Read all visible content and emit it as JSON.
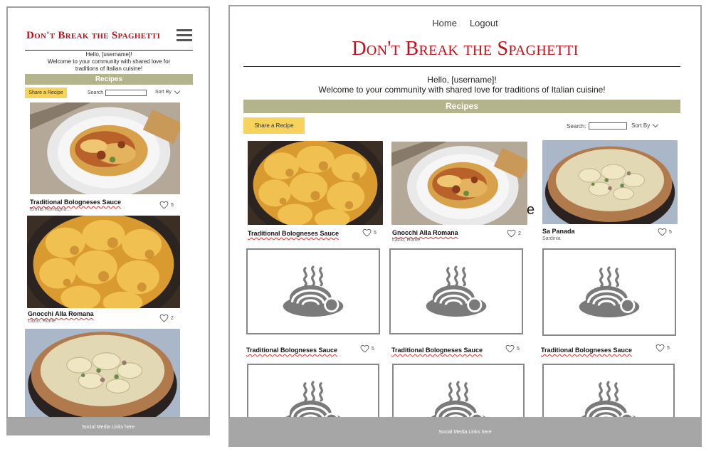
{
  "app": {
    "brand": "Don't Break the Spaghetti",
    "nav": {
      "home": "Home",
      "logout": "Logout"
    },
    "greeting": "Hello, [username]!",
    "welcome": "Welcome to your community with shared love for traditions of Italian cuisine!",
    "mobile_welcome_line1": "Welcome to your community with shared love for",
    "mobile_welcome_line2": "traditions of Italian cuisine!",
    "section_title": "Recipes",
    "share_button": "Share a Recipe",
    "search_label_mobile": "Search",
    "search_label_desktop": "Search:",
    "sort_label": "Sort By",
    "footer": "Social Media Links here"
  },
  "mobile_recipes": [
    {
      "name": "Traditional Bologneses Sauce",
      "location": "Emilia Romagna...",
      "likes": "5",
      "image": "pappardelle-bolognese"
    },
    {
      "name": "Gnocchi Alla Romana",
      "location": "Lazio, Rome",
      "likes": "2",
      "image": "baked-gnocchi"
    },
    {
      "name": "Sa Panada",
      "location": "Sardinia",
      "likes": "5",
      "image": "pie"
    }
  ],
  "desktop_recipes_row1": [
    {
      "name": "Traditional Bologneses Sauce",
      "location": "",
      "likes": "5",
      "image": "baked-gnocchi"
    },
    {
      "name": "Gnocchi Alla Romana",
      "location": "Lazio, Rome",
      "likes": "2",
      "image": "pappardelle-bolognese"
    },
    {
      "name": "Sa Panada",
      "location": "Sardinia",
      "likes": "5",
      "image": "pie"
    }
  ],
  "desktop_recipes_row2": [
    {
      "name": "Traditional Bologneses Sauce",
      "likes": "5",
      "image": "spaghetti-placeholder-icon"
    },
    {
      "name": "Traditional Bologneses Sauce",
      "likes": "5",
      "image": "spaghetti-placeholder-icon"
    },
    {
      "name": "Traditional Bologneses Sauce",
      "likes": "5",
      "image": "spaghetti-placeholder-icon"
    }
  ],
  "stray_glyph": "e",
  "colors": {
    "brand_red": "#c0101a",
    "band": "#b3b38c",
    "share_yellow": "#f7d35c",
    "footer_gray": "#a6a6a6"
  }
}
